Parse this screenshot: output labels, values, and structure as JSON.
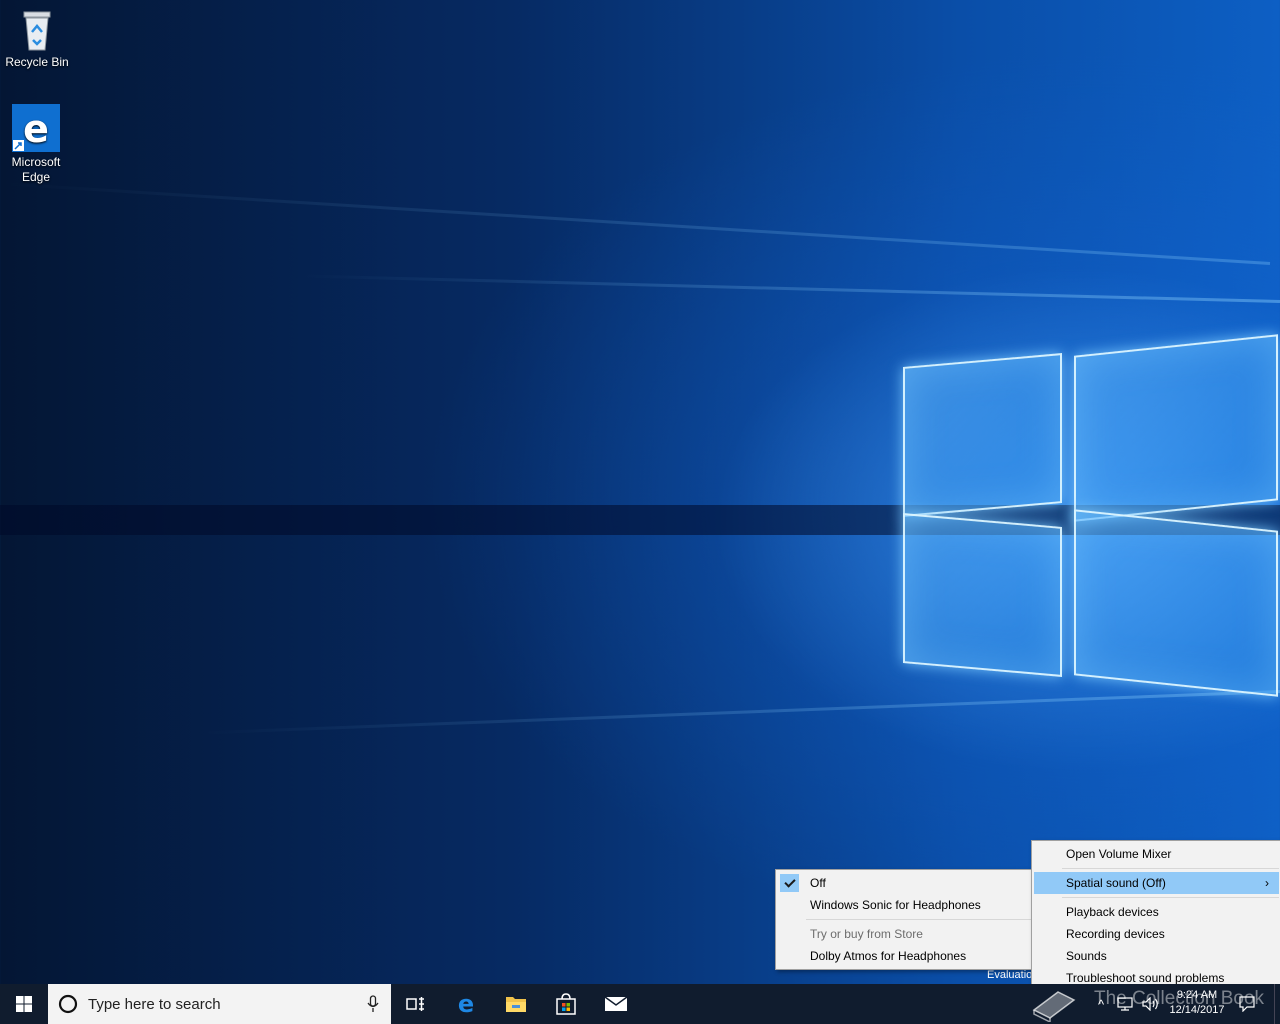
{
  "desktop": {
    "icons": [
      {
        "label": "Recycle Bin",
        "icon": "recycle-bin-icon"
      },
      {
        "label": "Microsoft\nEdge",
        "icon": "edge-icon"
      }
    ],
    "watermark": "Evaluation copy"
  },
  "spatial_submenu": {
    "items": [
      {
        "label": "Off",
        "checked": true
      },
      {
        "label": "Windows Sonic for Headphones"
      },
      {
        "label": "Try or buy from Store",
        "disabled": true
      },
      {
        "label": "Dolby Atmos for Headphones"
      }
    ]
  },
  "volume_menu": {
    "items": [
      {
        "label": "Open Volume Mixer"
      },
      {
        "label": "Spatial sound (Off)",
        "highlighted": true,
        "submenu": true
      },
      {
        "label": "Playback devices"
      },
      {
        "label": "Recording devices"
      },
      {
        "label": "Sounds"
      },
      {
        "label": "Troubleshoot sound problems"
      }
    ]
  },
  "taskbar": {
    "search_placeholder": "Type here to search",
    "apps": [
      "task-view-icon",
      "edge-icon",
      "file-explorer-icon",
      "store-icon",
      "mail-icon"
    ],
    "clock_time": "9:24 AM",
    "clock_date": "12/14/2017"
  },
  "overlay": {
    "brand": "The Collection Book"
  },
  "colors": {
    "menu_bg": "#f2f2f2",
    "menu_highlight": "#91c9f7",
    "taskbar_bg": "#101c2e"
  }
}
